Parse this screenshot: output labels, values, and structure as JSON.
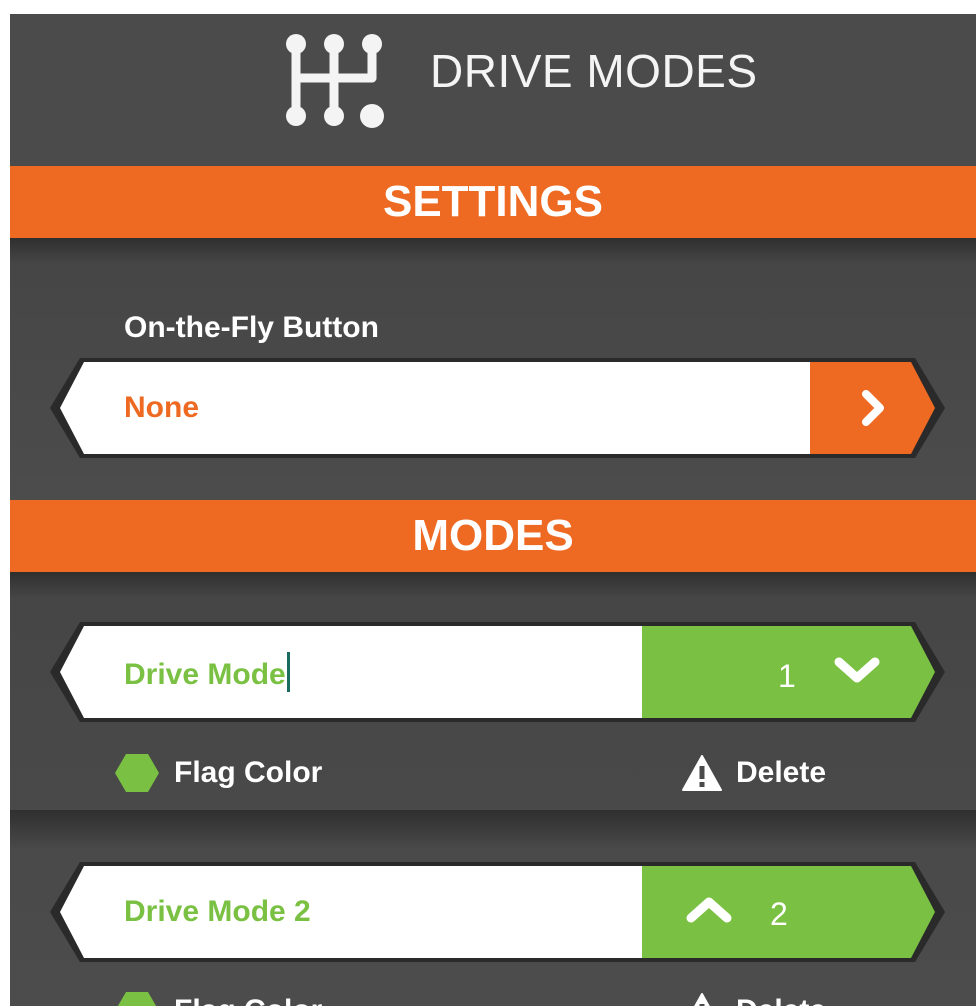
{
  "header": {
    "title": "DRIVE MODES",
    "icon": "gear-shift-icon"
  },
  "settings": {
    "section_title": "SETTINGS",
    "on_the_fly": {
      "label": "On-the-Fly Button",
      "value": "None",
      "action_icon": "chevron-right-icon"
    }
  },
  "modes": {
    "section_title": "MODES",
    "items": [
      {
        "name": "Drive Mode",
        "number": "1",
        "toggle_icon": "chevron-down-icon",
        "flag_label": "Flag Color",
        "flag_color": "#7ac143",
        "delete_label": "Delete"
      },
      {
        "name": "Drive Mode 2",
        "number": "2",
        "toggle_icon": "chevron-up-icon",
        "flag_label": "Flag Color",
        "flag_color": "#7ac143",
        "delete_label": "Delete"
      }
    ]
  },
  "colors": {
    "accent_orange": "#ee6a22",
    "mode_green": "#7ac143",
    "background": "#4a4a4a",
    "text_white": "#ffffff"
  }
}
